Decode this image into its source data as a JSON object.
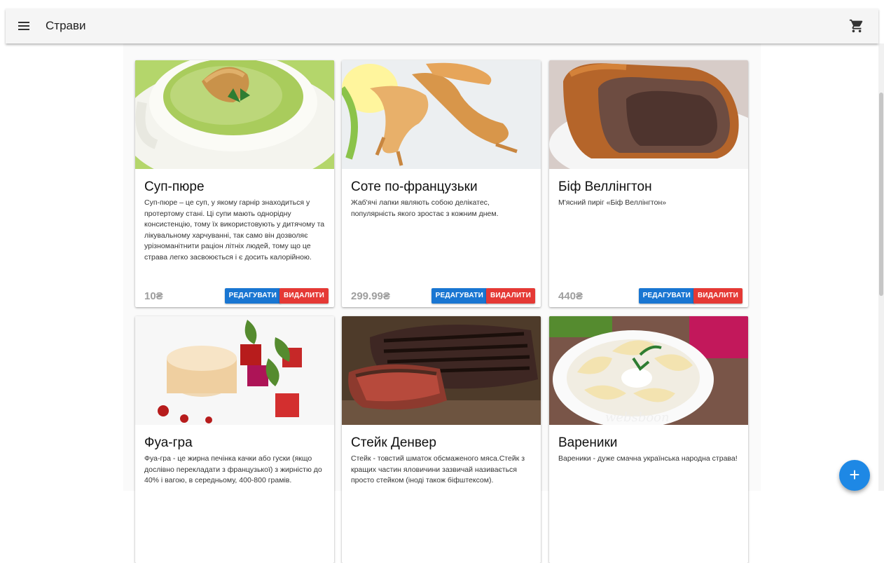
{
  "appbar": {
    "title": "Страви",
    "menu_icon": "menu-icon",
    "cart_icon": "cart-icon"
  },
  "cards": [
    {
      "title": "Суп-пюре",
      "description": "Суп-пюре – це суп, у якому гарнір знаходиться у протертому стані. Ці супи мають однорідну консистенцію, тому їх використовують у дитячому та лікувальному харчуванні, так само він дозволяє урізноманітнити раціон літніх людей, тому що це страва легко засвоюється і є досить калорійною.",
      "price": "10₴",
      "edit_label": "РЕДАГУВАТИ",
      "delete_label": "ВИДАЛИТИ"
    },
    {
      "title": "Соте по-французьки",
      "description": "Жаб'ячі лапки являють собою делікатес, популярність якого зростає з кожним днем.",
      "price": "299.99₴",
      "edit_label": "РЕДАГУВАТИ",
      "delete_label": "ВИДАЛИТИ"
    },
    {
      "title": "Біф Веллінгтон",
      "description": "М'ясний пиріг «Біф Веллінгтон»",
      "price": "440₴",
      "edit_label": "РЕДАГУВАТИ",
      "delete_label": "ВИДАЛИТИ"
    },
    {
      "title": "Фуа-гра",
      "description": "Фуа-гра - це жирна печінка качки або гуски (якщо дослівно перекладати з французької) з жирністю до 40% і вагою, в середньому, 400-800 грамів.",
      "price": "",
      "edit_label": "",
      "delete_label": ""
    },
    {
      "title": "Стейк Денвер",
      "description": "Стейк - товстий шматок обсмаженого мяса.Стейк з кращих частин яловичини зазвичай називається просто стейком (іноді також біфштексом).",
      "price": "",
      "edit_label": "",
      "delete_label": ""
    },
    {
      "title": "Вареники",
      "description": "Вареники - дуже смачна українська народна страва!",
      "price": "",
      "edit_label": "",
      "delete_label": "",
      "watermark": "websboon"
    }
  ],
  "fab": {
    "label": "+",
    "icon": "plus-icon"
  },
  "colors": {
    "edit": "#1976d2",
    "delete": "#e53935",
    "fab": "#1e88e5",
    "appbar": "#f5f5f5"
  }
}
